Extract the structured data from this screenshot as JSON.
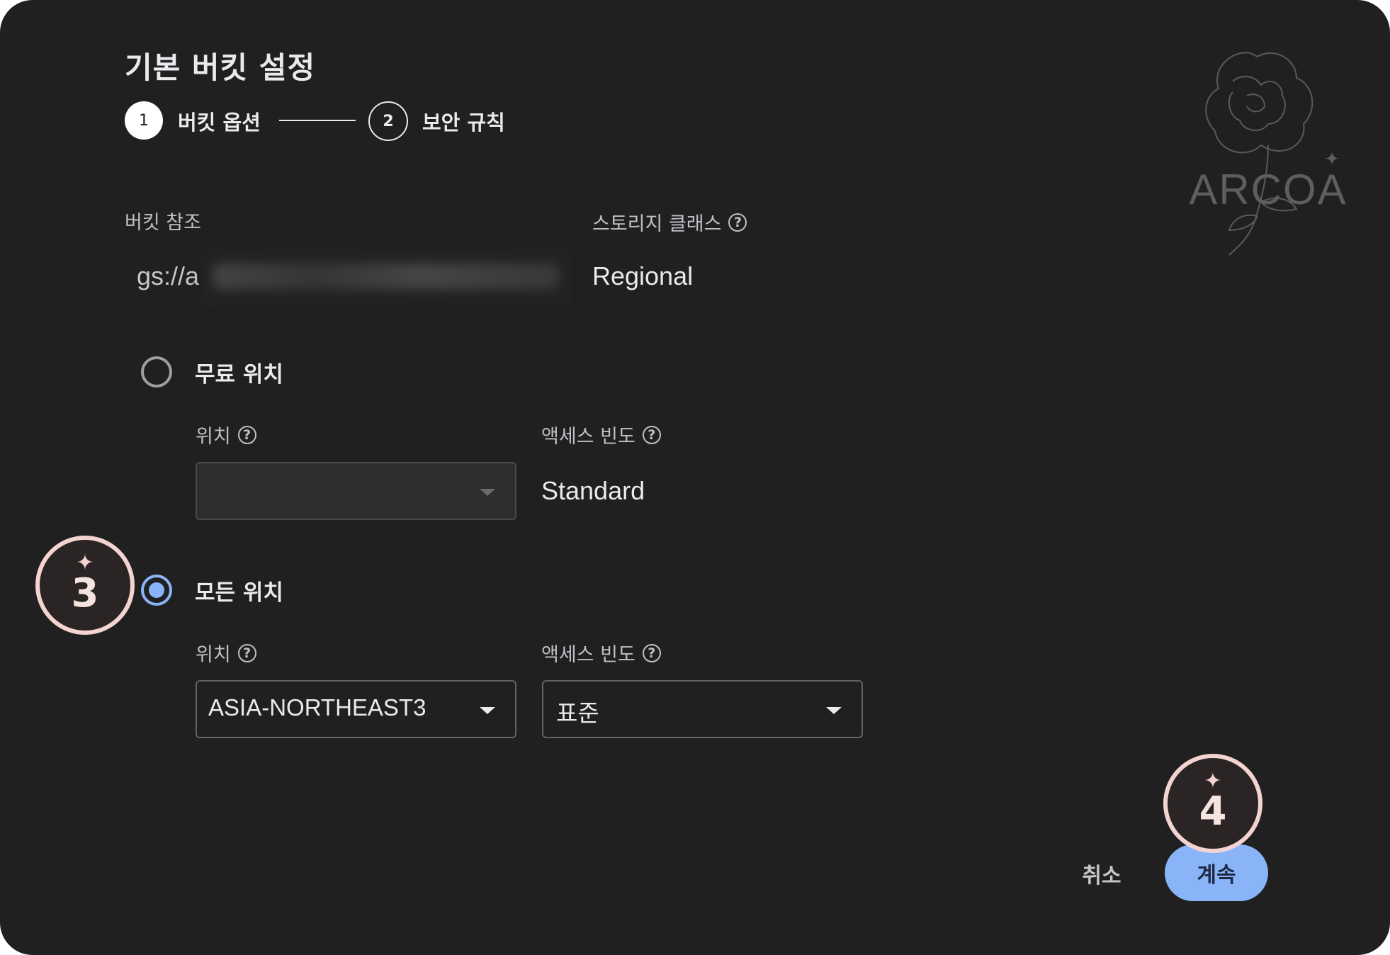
{
  "dialog": {
    "title": "기본 버킷 설정",
    "steps": [
      {
        "number": "1",
        "label": "버킷 옵션"
      },
      {
        "number": "2",
        "label": "보안 규칙"
      }
    ]
  },
  "bucket_reference": {
    "label": "버킷 참조",
    "value_prefix": "gs://a"
  },
  "storage_class": {
    "label": "스토리지 클래스",
    "value": "Regional"
  },
  "free_location": {
    "radio_label": "무료 위치",
    "checked": false,
    "location_label": "위치",
    "access_label": "액세스 빈도",
    "access_value": "Standard"
  },
  "all_location": {
    "radio_label": "모든 위치",
    "checked": true,
    "location_label": "위치",
    "location_value": "ASIA-NORTHEAST3",
    "access_label": "액세스 빈도",
    "access_value": "표준"
  },
  "buttons": {
    "cancel": "취소",
    "continue": "계속"
  },
  "annotations": [
    {
      "spark": "✦",
      "number": "3"
    },
    {
      "spark": "✦",
      "number": "4"
    }
  ],
  "logo": {
    "text": "ARCOA"
  },
  "icons": {
    "help": "help-circle-icon",
    "dropdown": "caret-down-icon",
    "spark": "sparkle-icon"
  },
  "colors": {
    "background": "#202020",
    "accent": "#8ab4f8",
    "badge": "#f3d4d0"
  }
}
